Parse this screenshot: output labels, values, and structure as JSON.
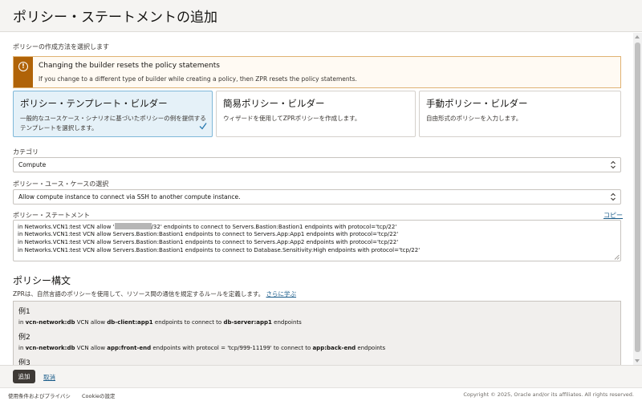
{
  "header": {
    "title": "ポリシー・ステートメントの追加"
  },
  "method_label": "ポリシーの作成方法を選択します",
  "warning": {
    "icon": "warning-icon",
    "title": "Changing the builder resets the policy statements",
    "description": "If you change to a different type of builder while creating a policy, then ZPR resets the policy statements."
  },
  "builders": [
    {
      "title": "ポリシー・テンプレート・ビルダー",
      "description": "一般的なユースケース・シナリオに基づいたポリシーの例を提供するテンプレートを選択します。",
      "selected": true
    },
    {
      "title": "簡易ポリシー・ビルダー",
      "description": "ウィザードを使用してZPRポリシーを作成します。",
      "selected": false
    },
    {
      "title": "手動ポリシー・ビルダー",
      "description": "自由形式のポリシーを入力します。",
      "selected": false
    }
  ],
  "category": {
    "label": "カテゴリ",
    "value": "Compute"
  },
  "use_case": {
    "label": "ポリシー・ユース・ケースの選択",
    "value": "Allow compute instance to connect via SSH to another compute instance."
  },
  "statement": {
    "label": "ポリシー・ステートメント",
    "copy": "コピー",
    "line1_prefix": "in Networks.VCN1:test VCN allow '",
    "line1_suffix": "/32' endpoints to connect to Servers.Bastion:Bastion1 endpoints with protocol='tcp/22'",
    "line2": "in Networks.VCN1:test VCN allow Servers.Bastion:Bastion1 endpoints to connect to Servers.App:App1 endpoints with protocol='tcp/22'",
    "line3": "in Networks.VCN1:test VCN allow Servers.Bastion:Bastion1 endpoints to connect to Servers.App:App2 endpoints with protocol='tcp/22'",
    "line4": "in Networks.VCN1:test VCN allow Servers.Bastion:Bastion1 endpoints to connect to Database.Sensitivity:High endpoints with protocol='tcp/22'"
  },
  "syntax": {
    "title": "ポリシー構文",
    "description": "ZPRは、自然言語のポリシーを使用して、リソース間の通信を規定するルールを定義します。",
    "learn_more": "さらに学ぶ",
    "examples": [
      {
        "label": "例1",
        "p1": "in ",
        "b1": "vcn-network:db",
        "p2": " VCN allow ",
        "b2": "db-client:app1",
        "p3": " endpoints to connect to ",
        "b3": "db-server:app1",
        "p4": " endpoints"
      },
      {
        "label": "例2",
        "p1": "in ",
        "b1": "vcn-network:db",
        "p2": " VCN allow ",
        "b2": "app:front-end",
        "p3": " endpoints with protocol = 'tcp/999-11199' to connect to ",
        "b3": "app:back-end",
        "p4": " endpoints"
      },
      {
        "label": "例3"
      }
    ]
  },
  "actions": {
    "add": "追加",
    "cancel": "取消"
  },
  "footer": {
    "terms": "使用条件およびプライバシ",
    "cookies": "Cookieの設定",
    "copyright": "Copyright © 2025, Oracle and/or its affiliates. All rights reserved."
  }
}
